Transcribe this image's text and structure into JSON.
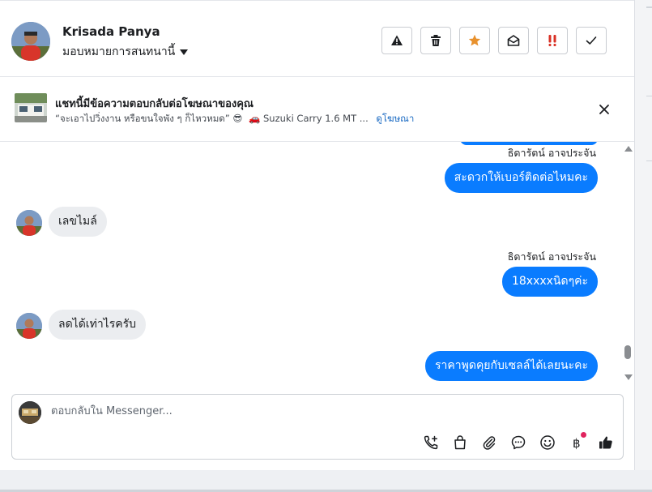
{
  "header": {
    "contact_name": "Krisada Panya",
    "assign_label": "มอบหมายการสนทนานี้",
    "toolbar": [
      {
        "icon": "warning-icon"
      },
      {
        "icon": "trash-icon"
      },
      {
        "icon": "star-icon",
        "color": "#e8912d"
      },
      {
        "icon": "envelope-open-icon"
      },
      {
        "icon": "exclamation-icon",
        "color": "#d93025"
      },
      {
        "icon": "check-icon"
      }
    ]
  },
  "ad_banner": {
    "title": "แชทนี้มีข้อความตอบกลับต่อโฆษณาของคุณ",
    "quote": "“จะเอาไปวิ่งงาน หรือขนใจพัง ๆ ก็ไหวหมด” 😎",
    "car_emoji": "🚗",
    "ad_name": "Suzuki Carry 1.6 MT ...",
    "view_ad_label": "ดูโฆษณา"
  },
  "messages": [
    {
      "type": "sender",
      "text": "ธิดารัตน์ อาจประจัน"
    },
    {
      "type": "out",
      "text": "สะดวกให้เบอร์ติดต่อไหมคะ"
    },
    {
      "type": "in",
      "text": "เลขไมล์"
    },
    {
      "type": "sender",
      "text": "ธิดารัตน์ อาจประจัน"
    },
    {
      "type": "out",
      "text": "18xxxxนิดๆค่ะ"
    },
    {
      "type": "in",
      "text": "ลดได้เท่าไรครับ"
    },
    {
      "type": "out",
      "text": "ราคาพูดคุยกับเซลล์ได้เลยนะคะ"
    }
  ],
  "composer": {
    "placeholder": "ตอบกลับใน Messenger...",
    "icons": [
      "call-add-icon",
      "shopping-bag-icon",
      "paperclip-icon",
      "chat-bubble-icon",
      "emoji-icon",
      "baht-icon",
      "thumbs-up-icon"
    ]
  },
  "colors": {
    "accent": "#0a7cff",
    "incoming_bubble": "#ebedf0",
    "link": "#1768c2"
  }
}
